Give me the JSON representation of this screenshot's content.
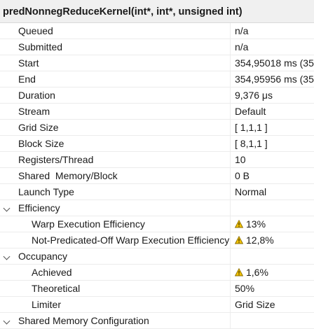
{
  "header": {
    "title": "predNonnegReduceKernel(int*, int*, unsigned int)"
  },
  "rows": [
    {
      "label": "Queued",
      "value": "n/a"
    },
    {
      "label": "Submitted",
      "value": "n/a"
    },
    {
      "label": "Start",
      "value": "354,95018 ms (35"
    },
    {
      "label": "End",
      "value": "354,95956 ms (35"
    },
    {
      "label": "Duration",
      "value": "9,376 μs"
    },
    {
      "label": "Stream",
      "value": "Default"
    },
    {
      "label": "Grid Size",
      "value": "[ 1,1,1 ]"
    },
    {
      "label": "Block Size",
      "value": "[ 8,1,1 ]"
    },
    {
      "label": "Registers/Thread",
      "value": "10"
    },
    {
      "label": "Shared  Memory/Block",
      "value": "0 B"
    },
    {
      "label": "Launch Type",
      "value": "Normal"
    }
  ],
  "efficiency": {
    "label": "Efficiency",
    "rows": [
      {
        "label": "Warp Execution Efficiency",
        "value": "13%",
        "warn": true
      },
      {
        "label": "Not-Predicated-Off Warp Execution Efficiency",
        "value": "12,8%",
        "warn": true
      }
    ]
  },
  "occupancy": {
    "label": "Occupancy",
    "rows": [
      {
        "label": "Achieved",
        "value": "1,6%",
        "warn": true
      },
      {
        "label": "Theoretical",
        "value": "50%"
      },
      {
        "label": "Limiter",
        "value": "Grid Size"
      }
    ]
  },
  "shared_memory": {
    "label": "Shared Memory Configuration"
  },
  "icons": {
    "warning": "warning-triangle-icon",
    "expand": "chevron-down-icon"
  },
  "colors": {
    "warning_fill": "#f2c200",
    "warning_stroke": "#8a6d00"
  }
}
